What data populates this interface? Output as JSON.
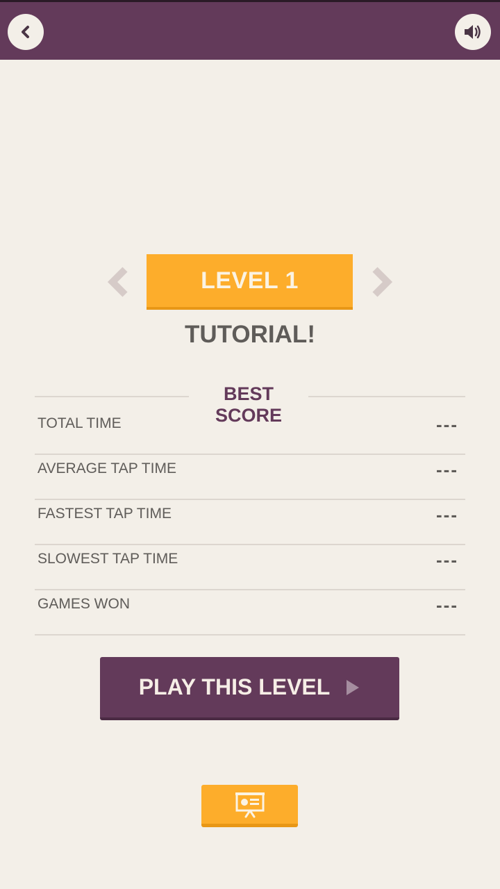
{
  "header": {
    "back_icon": "chevron-left-icon",
    "sound_icon": "speaker-icon"
  },
  "level": {
    "label": "LEVEL 1",
    "subtitle": "TUTORIAL!",
    "prev_icon": "chevron-left-icon",
    "next_icon": "chevron-right-icon"
  },
  "best_score": {
    "title": "BEST SCORE",
    "rows": [
      {
        "label": "TOTAL TIME",
        "value": "---"
      },
      {
        "label": "AVERAGE TAP TIME",
        "value": "---"
      },
      {
        "label": "FASTEST TAP TIME",
        "value": "---"
      },
      {
        "label": "SLOWEST TAP TIME",
        "value": "---"
      },
      {
        "label": "GAMES WON",
        "value": "---"
      }
    ]
  },
  "play_button": {
    "label": "PLAY THIS LEVEL",
    "icon": "play-icon"
  },
  "bottom_button": {
    "icon": "presentation-icon"
  },
  "colors": {
    "primary": "#633a5a",
    "accent": "#fdad2b",
    "background": "#f3efe8",
    "text": "#5f5c59"
  }
}
